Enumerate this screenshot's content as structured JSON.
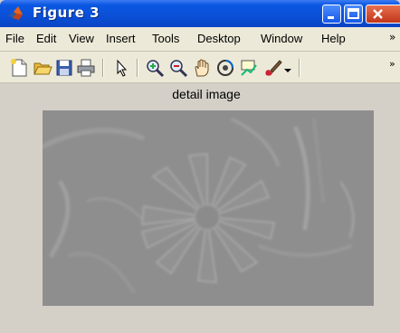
{
  "window": {
    "title": "Figure 3",
    "app_icon": "matlab-icon",
    "controls": [
      "minimize-icon",
      "maximize-icon",
      "close-icon"
    ]
  },
  "menubar": {
    "items": [
      "File",
      "Edit",
      "View",
      "Insert",
      "Tools",
      "Desktop",
      "Window",
      "Help"
    ],
    "more": "»"
  },
  "toolbar": {
    "icons": [
      "new-figure-icon",
      "open-file-icon",
      "save-icon",
      "print-icon",
      "select-arrow-icon",
      "zoom-in-icon",
      "zoom-out-icon",
      "pan-hand-icon",
      "rotate-3d-icon",
      "data-cursor-icon",
      "brush-icon",
      "dropdown-arrow-icon"
    ],
    "more": "»"
  },
  "figure": {
    "axes_title": "detail image",
    "image_description": "detail-image"
  },
  "colors": {
    "title_bar": "#0a4fd6",
    "figure_background": "#d4d0c8",
    "image_gray": "#8d8d8d"
  }
}
